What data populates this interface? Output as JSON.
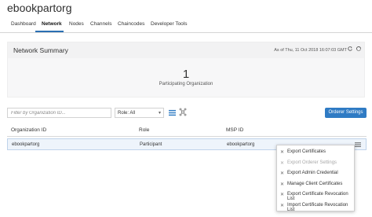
{
  "app": {
    "title": "ebookpartorg"
  },
  "tabs": [
    {
      "label": "Dashboard"
    },
    {
      "label": "Network"
    },
    {
      "label": "Nodes"
    },
    {
      "label": "Channels"
    },
    {
      "label": "Chaincodes"
    },
    {
      "label": "Developer Tools"
    }
  ],
  "active_tab": "Network",
  "summary": {
    "title": "Network Summary",
    "as_of": "As of Thu, 11 Oct 2018 16:07:03 GMT",
    "count": "1",
    "count_label": "Participating Organization"
  },
  "toolbar": {
    "filter_placeholder": "Filter by Organization ID...",
    "role_label": "Role: All",
    "orderer_button": "Orderer Settings"
  },
  "table": {
    "headers": [
      "Organization ID",
      "Role",
      "MSP ID"
    ],
    "rows": [
      {
        "org_id": "ebookpartorg",
        "role": "Participant",
        "msp_id": "ebookpartorg"
      }
    ]
  },
  "context_menu": {
    "items": [
      {
        "label": "Export Certificates",
        "disabled": false
      },
      {
        "label": "Export Orderer Settings",
        "disabled": true
      },
      {
        "label": "Export Admin Credential",
        "disabled": false
      },
      {
        "label": "Manage Client Certificates",
        "disabled": false
      },
      {
        "label": "Export Certificate Revocation List",
        "disabled": false
      },
      {
        "label": "Import Certificate Revocation List",
        "disabled": false
      }
    ]
  },
  "colors": {
    "accent": "#2f7bc4",
    "tab_underline": "#2a6fb3",
    "row_highlight": "#eef4fb"
  },
  "icons": [
    "refresh-icon",
    "sync-icon",
    "chevron-down-icon",
    "list-view-icon",
    "graph-view-icon",
    "hamburger-icon",
    "menu-item-icon"
  ]
}
